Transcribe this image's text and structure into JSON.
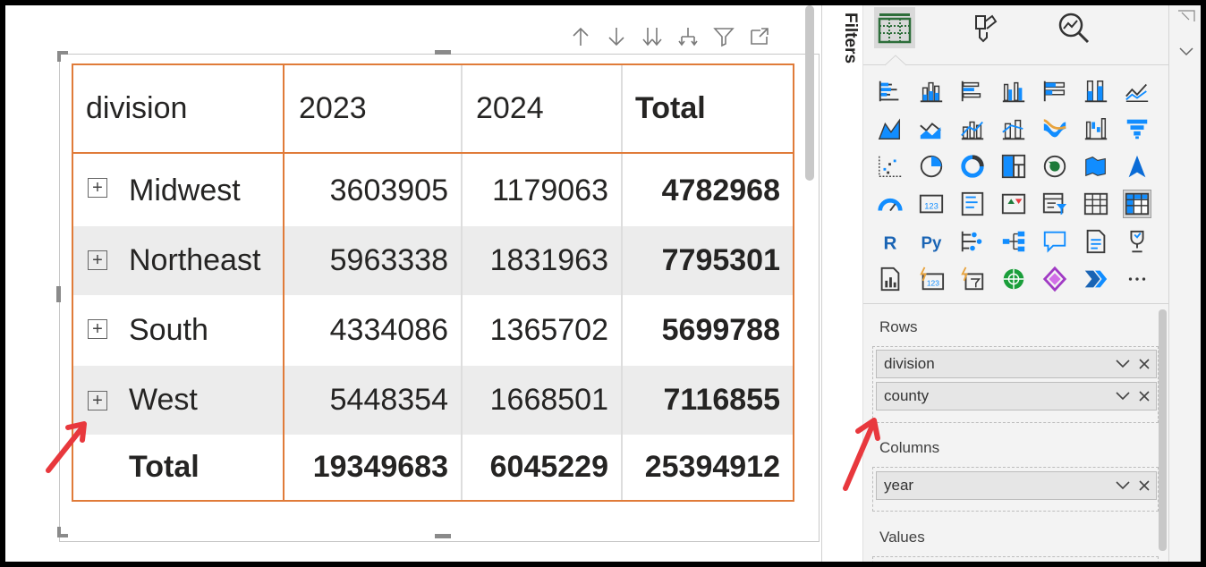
{
  "matrix": {
    "headers": [
      "division",
      "2023",
      "2024",
      "Total"
    ],
    "rows": [
      {
        "label": "Midwest",
        "v2023": "3603905",
        "v2024": "1179063",
        "total": "4782968"
      },
      {
        "label": "Northeast",
        "v2023": "5963338",
        "v2024": "1831963",
        "total": "7795301"
      },
      {
        "label": "South",
        "v2023": "4334086",
        "v2024": "1365702",
        "total": "5699788"
      },
      {
        "label": "West",
        "v2023": "5448354",
        "v2024": "1668501",
        "total": "7116855"
      }
    ],
    "total_row": {
      "label": "Total",
      "v2023": "19349683",
      "v2024": "6045229",
      "total": "25394912"
    },
    "expand_glyph": "+"
  },
  "toolbar": {
    "icons": [
      "drill-up-icon",
      "drill-down-icon",
      "expand-all-icon",
      "expand-hierarchy-icon",
      "filter-icon",
      "focus-mode-icon"
    ]
  },
  "filters_pane": {
    "label": "Filters"
  },
  "viz_pane": {
    "rows_label": "Rows",
    "rows_fields": [
      "division",
      "county"
    ],
    "columns_label": "Columns",
    "columns_fields": [
      "year"
    ],
    "values_label": "Values",
    "more_label": "···"
  },
  "colors": {
    "accent_orange": "#e07b39",
    "arrow_red": "#e8383d",
    "chart_blue": "#118dff"
  }
}
